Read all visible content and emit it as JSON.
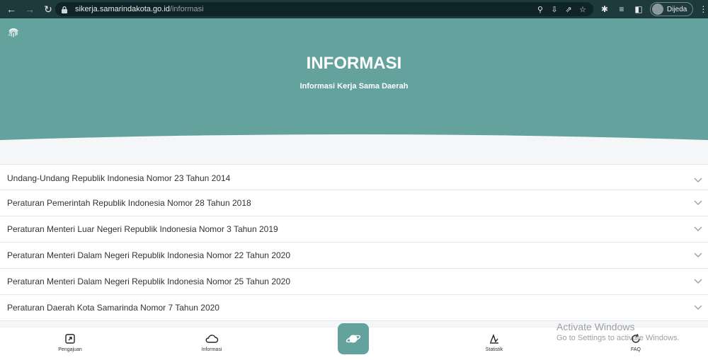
{
  "browser": {
    "url_host": "sikerja.samarindakota.go.id",
    "url_path": "/informasi",
    "profile_name": "Dijeda"
  },
  "hero": {
    "title": "INFORMASI",
    "subtitle": "Informasi Kerja Sama Daerah"
  },
  "accordion": {
    "items": [
      "Undang-Undang Republik Indonesia Nomor 23 Tahun 2014",
      "Peraturan Pemerintah Republik Indonesia Nomor 28 Tahun 2018",
      "Peraturan Menteri Luar Negeri Republik Indonesia Nomor 3 Tahun 2019",
      "Peraturan Menteri Dalam Negeri Republik Indonesia Nomor 22 Tahun 2020",
      "Peraturan Menteri Dalam Negeri Republik Indonesia Nomor 25 Tahun 2020",
      "Peraturan Daerah Kota Samarinda Nomor 7 Tahun 2020"
    ]
  },
  "bottom_nav": {
    "pengajuan": "Pengajuan",
    "informasi": "Informasi",
    "statistik": "Statistik",
    "faq": "FAQ"
  },
  "watermark": {
    "line1": "Activate Windows",
    "line2": "Go to Settings to activate Windows."
  },
  "colors": {
    "brand": "#64a29e",
    "browser_bar": "#1f3a3d"
  }
}
